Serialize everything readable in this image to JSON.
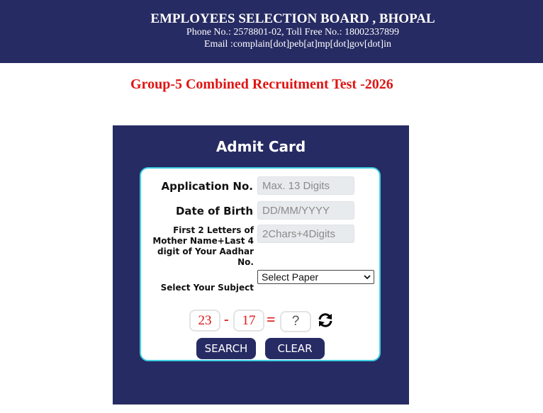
{
  "header": {
    "board_name": "EMPLOYEES SELECTION BOARD , BHOPAL",
    "phone_line": "Phone No.: 2578801-02, Toll Free No.: 18002337899",
    "email_line": "Email :complain[dot]peb[at]mp[dot]gov[dot]in",
    "background": "#272b63"
  },
  "exam_title": "Group-5 Combined Recruitment Test -2026",
  "panel": {
    "title": "Admit Card",
    "fields": {
      "application_no": {
        "label": "Application No.",
        "placeholder": "Max. 13 Digits",
        "value": ""
      },
      "dob": {
        "label": "Date of Birth",
        "placeholder": "DD/MM/YYYY",
        "value": ""
      },
      "mother_aadhar": {
        "label": "First 2 Letters of Mother Name+Last 4 digit of Your Aadhar No.",
        "placeholder": "2Chars+4Digits",
        "value": ""
      },
      "subject": {
        "label": "Select Your Subject",
        "selected": "Select Paper"
      }
    },
    "captcha": {
      "num1": "23",
      "operator": "-",
      "num2": "17",
      "equals": "=",
      "answer_placeholder": "?",
      "refresh_icon": "refresh-icon"
    },
    "buttons": {
      "search": "SEARCH",
      "clear": "CLEAR"
    }
  },
  "colors": {
    "navy": "#272b63",
    "accent_red": "#e01414",
    "box_border": "#3fd0e4"
  }
}
